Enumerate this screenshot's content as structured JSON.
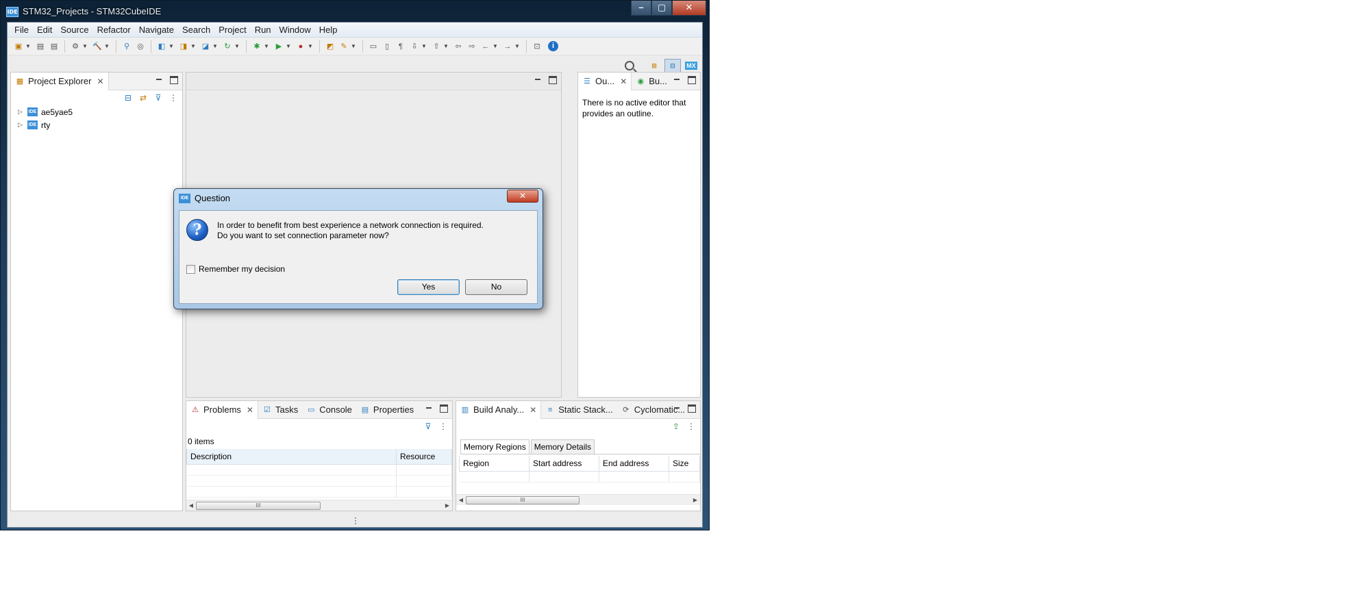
{
  "window": {
    "title": "STM32_Projects - STM32CubeIDE",
    "app_icon": "IDE"
  },
  "menu": [
    "File",
    "Edit",
    "Source",
    "Refactor",
    "Navigate",
    "Search",
    "Project",
    "Run",
    "Window",
    "Help"
  ],
  "perspective": {
    "mx_label": "MX"
  },
  "project_explorer": {
    "tab_label": "Project Explorer",
    "items": [
      {
        "label": "ae5yae5",
        "icon": "IDE"
      },
      {
        "label": "rty",
        "icon": "IDE"
      }
    ]
  },
  "outline": {
    "tab_label": "Ou...",
    "build_tab_label": "Bu...",
    "message_line1": "There is no active editor that",
    "message_line2": "provides an outline."
  },
  "problems": {
    "tabs": [
      "Problems",
      "Tasks",
      "Console",
      "Properties"
    ],
    "count": "0 items",
    "columns": [
      "Description",
      "Resource"
    ]
  },
  "build": {
    "tabs": [
      "Build Analy...",
      "Static Stack...",
      "Cyclomatic..."
    ],
    "subtabs": [
      "Memory Regions",
      "Memory Details"
    ],
    "columns": [
      "Region",
      "Start address",
      "End address",
      "Size"
    ]
  },
  "dialog": {
    "title": "Question",
    "icon": "IDE",
    "message_line1": "In order to benefit from best experience a network connection is required.",
    "message_line2": "Do you want to set connection parameter now?",
    "checkbox_label": "Remember my decision",
    "checkbox_checked": false,
    "yes_label": "Yes",
    "no_label": "No"
  },
  "colors": {
    "accent": "#3c8fd8",
    "close_red": "#c23b21",
    "header_bg": "#eaf2fa"
  }
}
